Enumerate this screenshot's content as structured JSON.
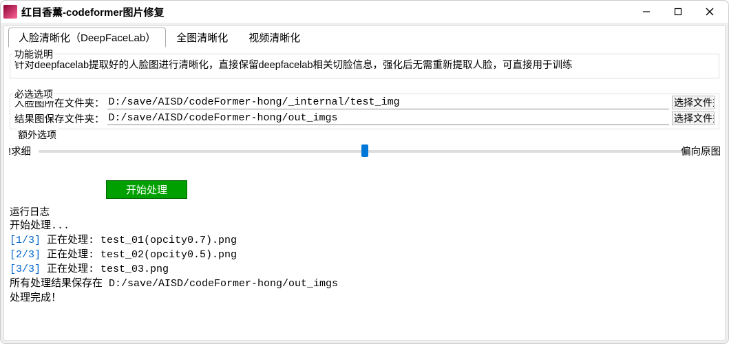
{
  "window": {
    "title": "红目香薰-codeformer图片修复"
  },
  "tabs": [
    {
      "label": "人脸清晰化（DeepFaceLab）",
      "active": true
    },
    {
      "label": "全图清晰化",
      "active": false
    },
    {
      "label": "视频清晰化",
      "active": false
    }
  ],
  "desc": {
    "legend": "功能说明",
    "text": "针对deepfacelab提取好的人脸图进行清晰化，直接保留deepfacelab相关切脸信息，强化后无需重新提取人脸，可直接用于训练"
  },
  "required": {
    "legend": "必选选项",
    "row1_label": "人脸图所在文件夹：",
    "row1_value": "D:/save/AISD/codeFormer-hong/_internal/test_img",
    "row2_label": "结果图保存文件夹：",
    "row2_value": "D:/save/AISD/codeFormer-hong/out_imgs",
    "browse_label": "选择文件夹"
  },
  "extra": {
    "legend": "额外选项",
    "left_label": "!求细",
    "right_label": "偏向原图"
  },
  "process_btn": "开始处理",
  "log": {
    "label": "运行日志",
    "line1": "开始处理...",
    "line2a": "[1/3]",
    "line2b": " 正在处理: test_01(opcity0.7).png",
    "line3a": "[2/3]",
    "line3b": " 正在处理: test_02(opcity0.5).png",
    "line4a": "[3/3]",
    "line4b": " 正在处理: test_03.png",
    "line5": "所有处理结果保存在 D:/save/AISD/codeFormer-hong/out_imgs",
    "line6": "处理完成！"
  }
}
